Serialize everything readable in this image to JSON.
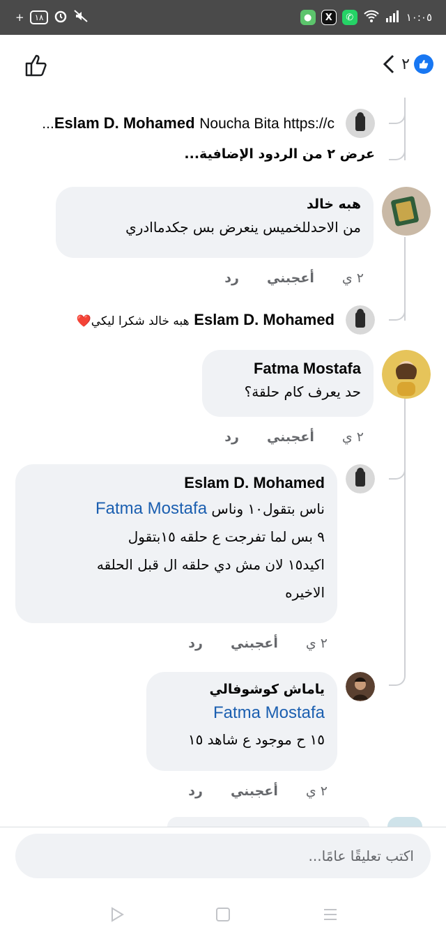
{
  "status_bar": {
    "time": "١٠:٠٥",
    "battery": "١٨",
    "icons": [
      "charging-icon",
      "battery-icon",
      "alarm-icon",
      "mute-icon",
      "app-icon",
      "x-app-icon",
      "whatsapp-icon",
      "wifi-icon",
      "signal-icon"
    ]
  },
  "header": {
    "reaction_count": "٢",
    "reaction_icon": "like-icon",
    "back_icon": "chevron-left-icon",
    "like_button_icon": "thumbs-up-icon"
  },
  "thread": [
    {
      "type": "inline",
      "author": "Eslam D. Mohamed",
      "text": "Noucha Bita https://c..."
    },
    {
      "type": "more",
      "text": "عرض ٢ من الردود الإضافية..."
    },
    {
      "type": "comment",
      "author": "هبه خالد",
      "text": "من الاحدللخميس ينعرض بس جكدماادري",
      "time": "٢ ي",
      "like_label": "أعجبني",
      "reply_label": "رد"
    },
    {
      "type": "inline",
      "author": "Eslam D. Mohamed",
      "text": "هبه خالد شكرا ليكي❤️"
    },
    {
      "type": "comment",
      "author": "Fatma Mostafa",
      "text": "حد يعرف كام حلقة؟",
      "time": "٢ ي",
      "like_label": "أعجبني",
      "reply_label": "رد"
    },
    {
      "type": "comment",
      "author": "Eslam D. Mohamed",
      "mention": "Fatma Mostafa",
      "lines": [
        "ناس بتقول١٠ وناس",
        "٩  بس لما تفرجت ع حلقه ١٥بتقول",
        "اكيد١٥ لان مش دي حلقه ال قبل الحلقه",
        "الاخيره"
      ],
      "time": "٢ ي",
      "like_label": "أعجبني",
      "reply_label": "رد"
    },
    {
      "type": "comment",
      "author": "ياماش كوشوفالي",
      "mention": "Fatma Mostafa",
      "text": "١٥ ح موجود ع شاهد ١٥",
      "time": "٢ ي",
      "like_label": "أعجبني",
      "reply_label": "رد"
    }
  ],
  "composer": {
    "placeholder": "اكتب تعليقًا عامًا..."
  },
  "nav": {
    "icons": [
      "back-triangle-icon",
      "home-square-icon",
      "menu-lines-icon"
    ]
  }
}
